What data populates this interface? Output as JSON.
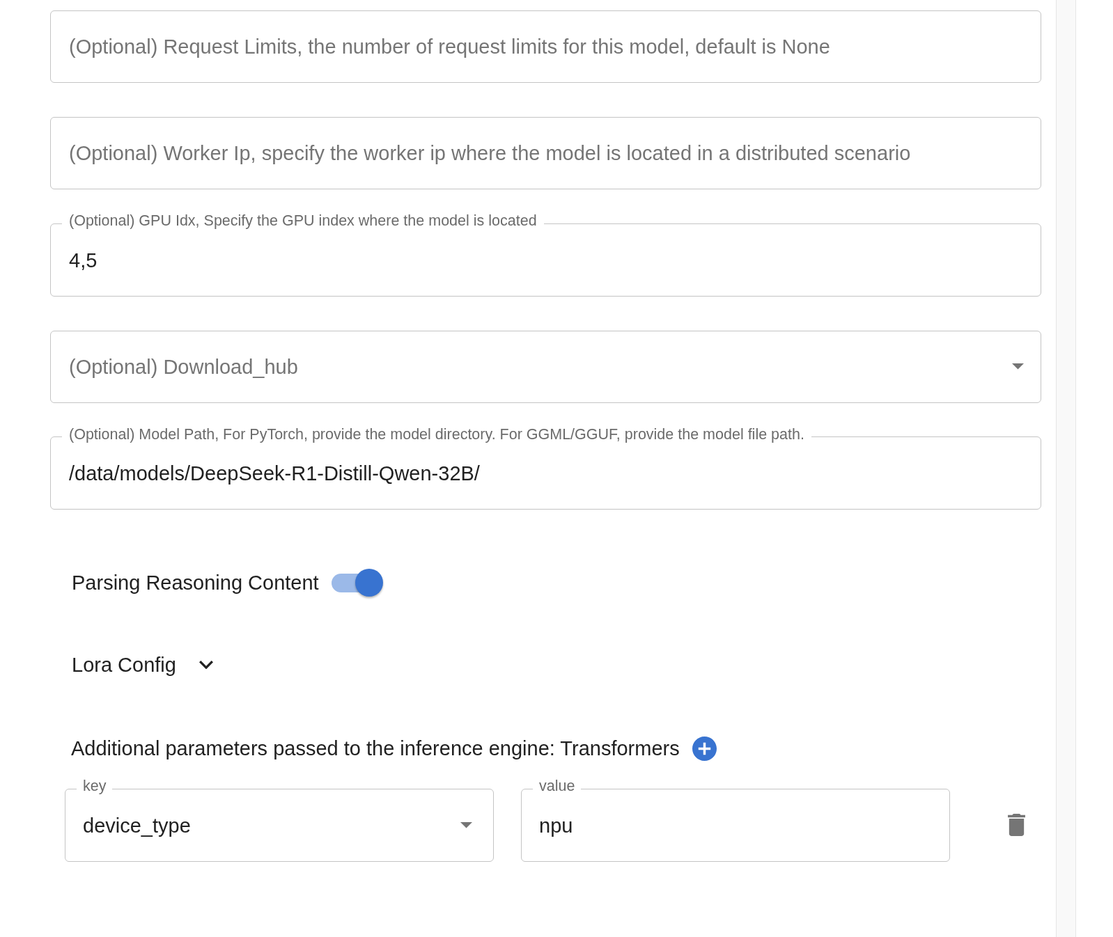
{
  "fields": [
    {
      "kind": "text",
      "placeholder": "(Optional) Request Limits, the number of request limits for this model, default is None"
    },
    {
      "kind": "text",
      "placeholder": "(Optional) Worker Ip, specify the worker ip where the model is located in a distributed scenario"
    },
    {
      "kind": "text",
      "label": "(Optional) GPU Idx, Specify the GPU index where the model is located",
      "value": "4,5"
    },
    {
      "kind": "select",
      "placeholder": "(Optional) Download_hub"
    },
    {
      "kind": "text",
      "label": "(Optional) Model Path, For PyTorch, provide the model directory. For GGML/GGUF, provide the model file path.",
      "value": "/data/models/DeepSeek-R1-Distill-Qwen-32B/"
    }
  ],
  "reasoning_toggle": {
    "label": "Parsing Reasoning Content",
    "on": true
  },
  "lora_config": {
    "label": "Lora Config",
    "expanded": false
  },
  "additional_parameters": {
    "title": "Additional parameters passed to the inference engine: Transformers",
    "rows": [
      {
        "key": {
          "kind": "select",
          "label": "key",
          "value": "device_type"
        },
        "value": {
          "kind": "text",
          "label": "value",
          "value": "npu"
        }
      }
    ]
  }
}
